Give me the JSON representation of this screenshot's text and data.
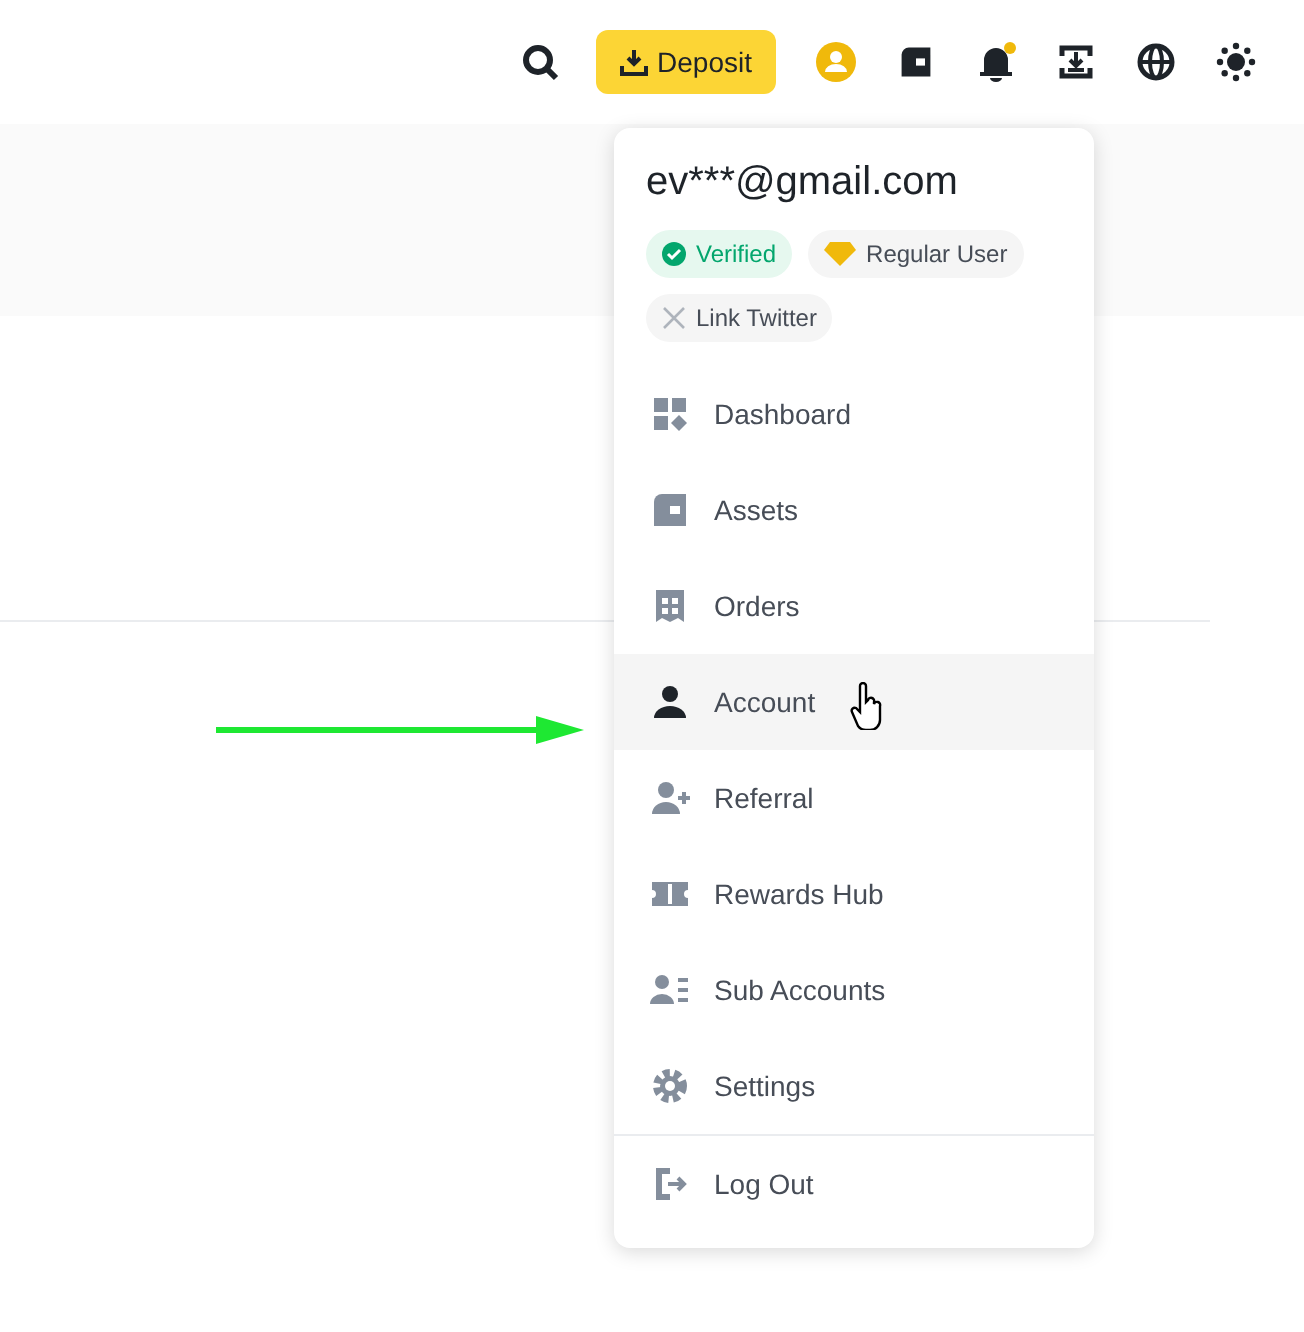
{
  "header": {
    "deposit_button": "Deposit",
    "notification_unread": true
  },
  "account_menu": {
    "email": "ev***@gmail.com",
    "badges": [
      {
        "label": "Verified",
        "kind": "verified"
      },
      {
        "label": "Regular User",
        "kind": "tier"
      },
      {
        "label": "Link Twitter",
        "kind": "twitter"
      }
    ],
    "items": [
      {
        "label": "Dashboard",
        "hovered": false
      },
      {
        "label": "Assets",
        "hovered": false
      },
      {
        "label": "Orders",
        "hovered": false
      },
      {
        "label": "Account",
        "hovered": true
      },
      {
        "label": "Referral",
        "hovered": false
      },
      {
        "label": "Rewards Hub",
        "hovered": false
      },
      {
        "label": "Sub Accounts",
        "hovered": false
      },
      {
        "label": "Settings",
        "hovered": false
      }
    ],
    "footer_item": {
      "label": "Log Out"
    }
  }
}
